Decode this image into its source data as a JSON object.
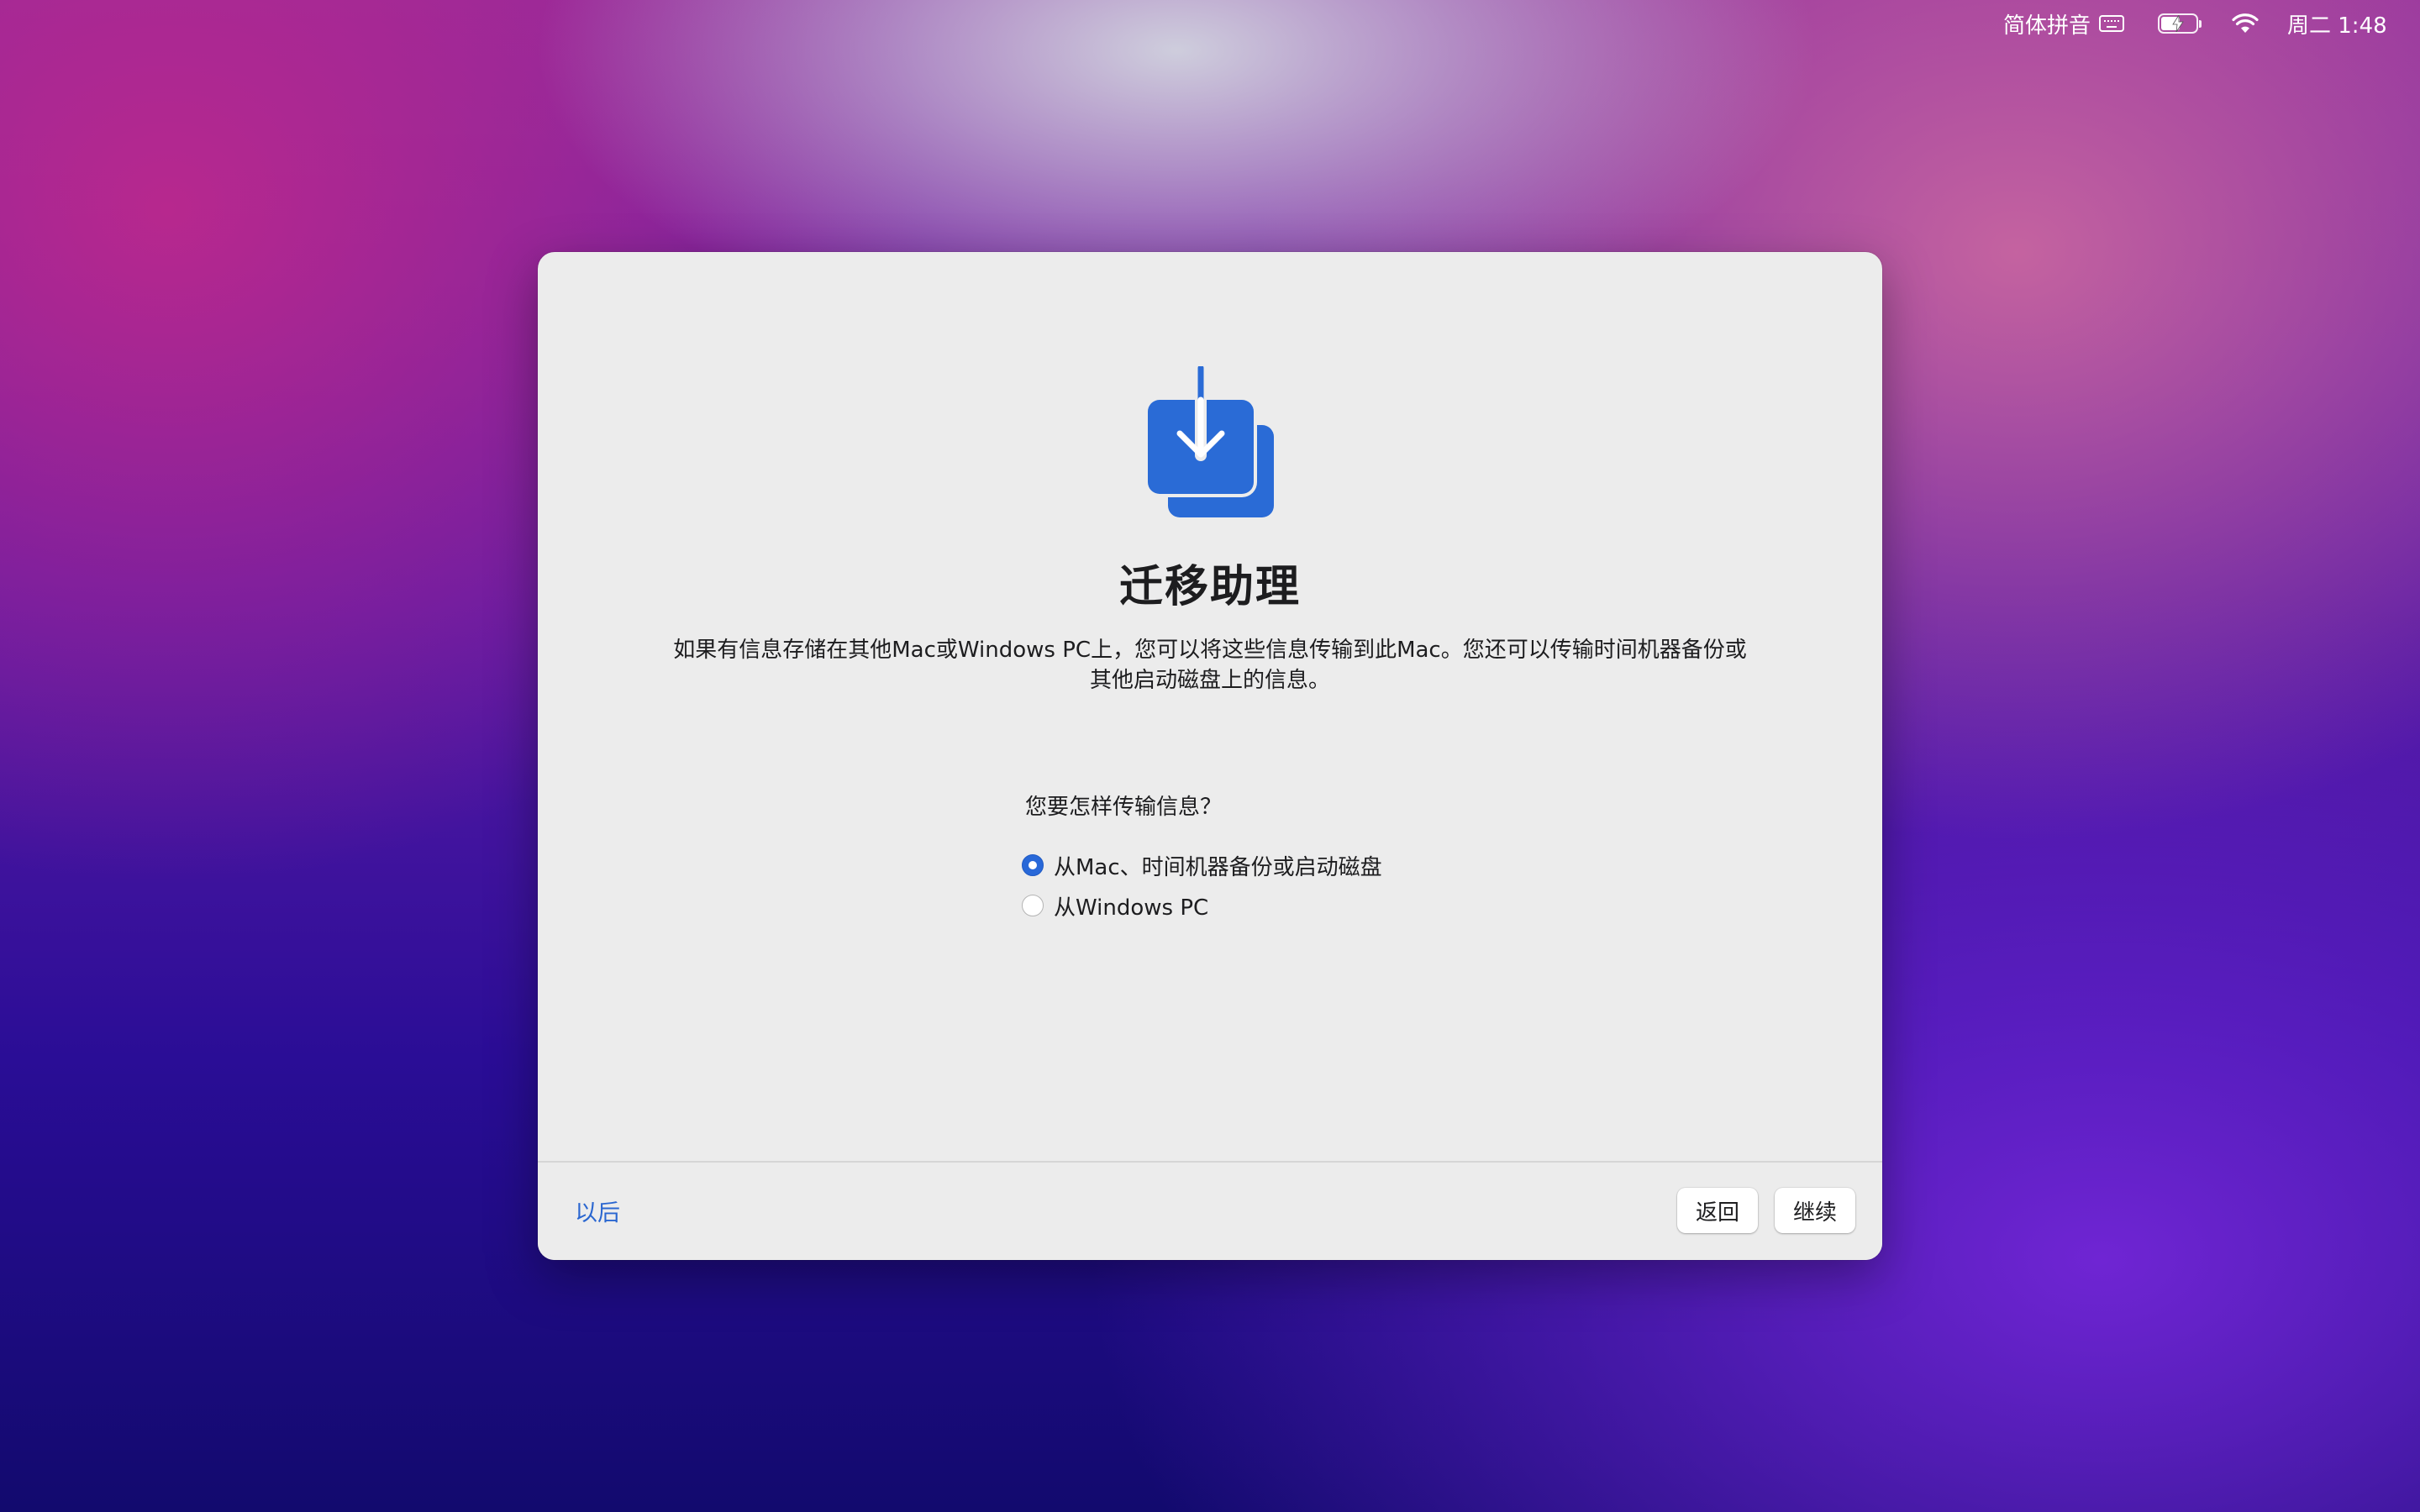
{
  "menubar": {
    "input_method": "简体拼音",
    "battery_level": 0.55,
    "clock": "周二 1:48"
  },
  "dialog": {
    "title": "迁移助理",
    "description": "如果有信息存储在其他Mac或Windows PC上，您可以将这些信息传输到此Mac。您还可以传输时间机器备份或其他启动磁盘上的信息。",
    "question": "您要怎样传输信息？",
    "options": [
      {
        "label": "从Mac、时间机器备份或启动磁盘",
        "selected": true
      },
      {
        "label": "从Windows PC",
        "selected": false
      }
    ],
    "footer": {
      "later": "以后",
      "back": "返回",
      "continue": "继续"
    },
    "accent_color": "#2868d8"
  }
}
